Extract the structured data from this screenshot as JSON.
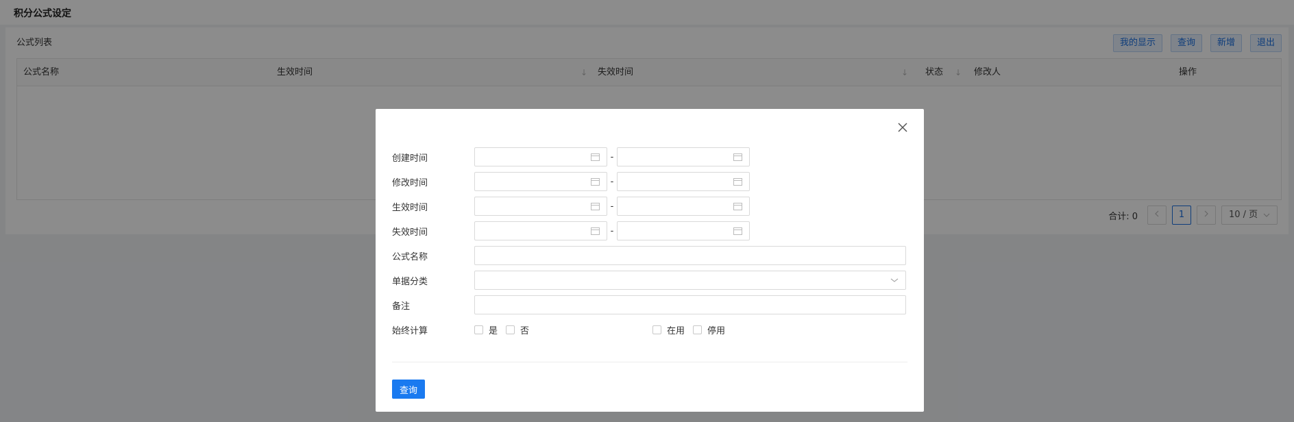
{
  "page": {
    "title": "积分公式设定"
  },
  "panel": {
    "title": "公式列表"
  },
  "toolbar": {
    "my_display": "我的显示",
    "query": "查询",
    "add": "新增",
    "exit": "退出"
  },
  "table": {
    "columns": [
      "公式名称",
      "生效时间",
      "失效时间",
      "状态",
      "修改人",
      "操作"
    ]
  },
  "pager": {
    "total_label": "合计:",
    "total": "0",
    "current_page": "1",
    "page_size": "10 / 页"
  },
  "modal": {
    "fields": {
      "created_time": "创建时间",
      "modified_time": "修改时间",
      "effective_time": "生效时间",
      "expire_time": "失效时间",
      "formula_name": "公式名称",
      "doc_category": "单据分类",
      "remark": "备注",
      "always_calc": "始终计算"
    },
    "range_separator": "-",
    "always_calc_options": {
      "yes": "是",
      "no": "否"
    },
    "status_options": {
      "in_use": "在用",
      "disabled": "停用"
    },
    "query_button": "查询"
  },
  "colors": {
    "primary": "#1a7af0",
    "mask": "rgba(0,0,0,0.45)"
  }
}
